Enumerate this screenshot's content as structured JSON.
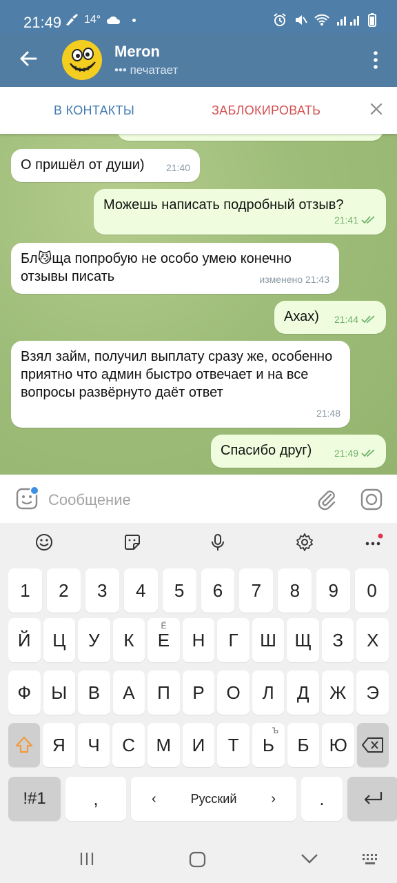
{
  "status": {
    "time": "21:49",
    "temperature": "14°",
    "icons_left": [
      "broom-icon",
      "cloud-icon",
      "dot-icon"
    ],
    "icons_right": [
      "alarm-icon",
      "mute-icon",
      "wifi-icon",
      "signal-icon",
      "battery-icon"
    ]
  },
  "header": {
    "title": "Meron",
    "status": "••• печатает"
  },
  "actions": {
    "add_contact": "В КОНТАКТЫ",
    "block": "ЗАБЛОКИРОВАТЬ"
  },
  "messages": [
    {
      "direction": "in",
      "text": "О пришёл от души)",
      "time": "21:40"
    },
    {
      "direction": "out",
      "text": "Можешь написать подробный отзыв?",
      "time": "21:41",
      "read": true
    },
    {
      "direction": "in",
      "text": "Бл😼ща попробую не особо умею конечно отзывы писать",
      "time": "изменено 21:43"
    },
    {
      "direction": "out",
      "text": "Ахах)",
      "time": "21:44",
      "read": true
    },
    {
      "direction": "in",
      "text": "Взял займ, получил выплату сразу же, особенно приятно что админ быстро отвечает и на все вопросы развёрнуто даёт ответ",
      "time": "21:48"
    },
    {
      "direction": "out",
      "text": "Спасибо друг)",
      "time": "21:49",
      "read": true
    }
  ],
  "input": {
    "placeholder": "Сообщение"
  },
  "keyboard": {
    "numbers": [
      "1",
      "2",
      "3",
      "4",
      "5",
      "6",
      "7",
      "8",
      "9",
      "0"
    ],
    "row1": [
      "Й",
      "Ц",
      "У",
      "К",
      "Е",
      "Н",
      "Г",
      "Ш",
      "Щ",
      "З",
      "Х"
    ],
    "row1_sup": {
      "Е": "Ё"
    },
    "row2": [
      "Ф",
      "Ы",
      "В",
      "А",
      "П",
      "Р",
      "О",
      "Л",
      "Д",
      "Ж",
      "Э"
    ],
    "row3": [
      "Я",
      "Ч",
      "С",
      "М",
      "И",
      "Т",
      "Ь",
      "Б",
      "Ю"
    ],
    "row3_sup": {
      "Ь": "Ъ"
    },
    "symbols": "!#1",
    "comma": ",",
    "space": "Русский",
    "period": "."
  },
  "colors": {
    "header": "#527da3",
    "accent_blue": "#3f79b0",
    "block_red": "#d44f4f",
    "outgoing_bubble": "#effdde"
  }
}
